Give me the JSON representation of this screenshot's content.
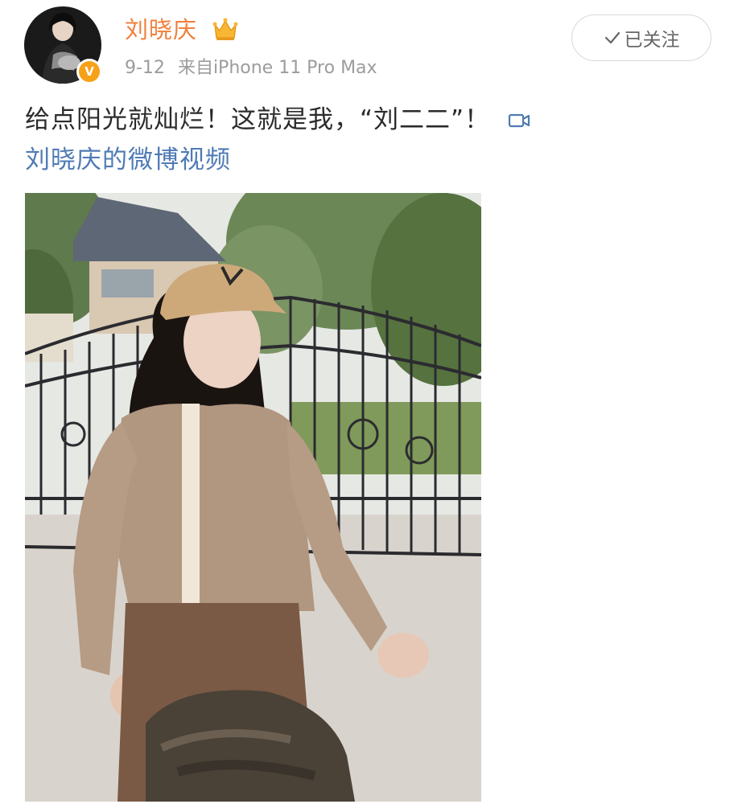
{
  "post": {
    "author": {
      "name": "刘晓庆",
      "avatar_icon": "profile-photo",
      "verified_icon": "verified-v-badge",
      "verified_letter": "V",
      "member_icon": "crown-icon"
    },
    "meta": {
      "date": "9-12",
      "source": "来自iPhone 11 Pro Max"
    },
    "follow_button": {
      "label": "已关注",
      "icon": "check-icon"
    },
    "text": "给点阳光就灿烂！这就是我，“刘二二”！",
    "video_link": {
      "icon": "video-camera-icon",
      "label": "刘晓庆的微博视频"
    },
    "image": {
      "icon": "photo"
    }
  },
  "colors": {
    "author_name": "#f0803c",
    "link": "#4f7bb4",
    "meta": "#9c9c9c",
    "badge": "#f6a118",
    "text": "#2b2b2b"
  }
}
